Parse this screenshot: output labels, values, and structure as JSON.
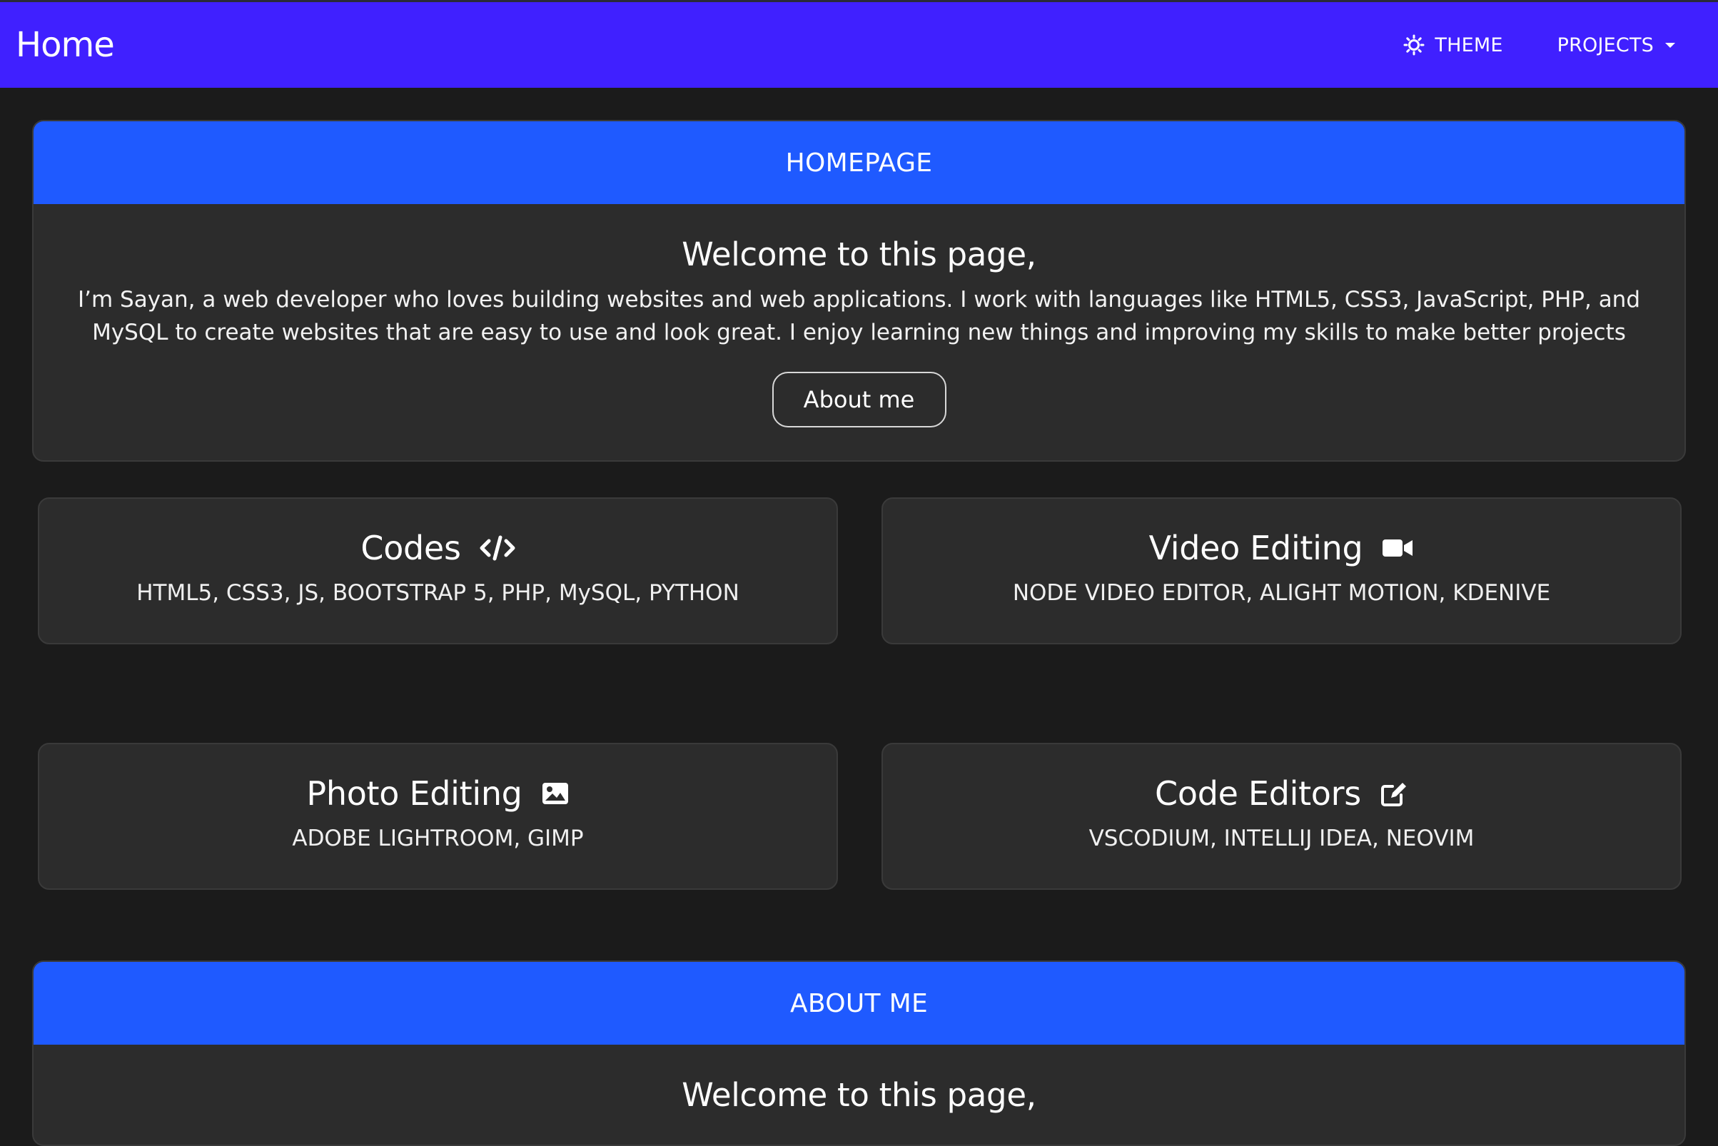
{
  "navbar": {
    "brand": "Home",
    "theme_label": "THEME",
    "projects_label": "PROJECTS"
  },
  "homepage": {
    "header": "HOMEPAGE",
    "welcome": "Welcome to this page,",
    "intro": "I’m Sayan, a web developer who loves building websites and web applications. I work with languages like HTML5, CSS3, JavaScript, PHP, and MySQL to create websites that are easy to use and look great. I enjoy learning new things and improving my skills to make better projects",
    "about_button": "About me"
  },
  "cards": [
    {
      "title": "Codes",
      "text": "HTML5, CSS3, JS, BOOTSTRAP 5, PHP, MySQL, PYTHON",
      "icon": "code-icon"
    },
    {
      "title": "Video Editing",
      "text": "NODE VIDEO EDITOR, ALIGHT MOTION, KDENIVE",
      "icon": "video-camera-icon"
    },
    {
      "title": "Photo Editing",
      "text": "ADOBE LIGHTROOM, GIMP",
      "icon": "image-icon"
    },
    {
      "title": "Code Editors",
      "text": "VSCODIUM, INTELLIJ IDEA, NEOVIM",
      "icon": "edit-icon"
    }
  ],
  "about": {
    "header": "ABOUT ME",
    "welcome": "Welcome to this page,"
  },
  "colors": {
    "navbar": "#4020ff",
    "section_header": "#1f5aff",
    "page_background": "#1b1b1b",
    "card_background": "#2c2c2c"
  }
}
